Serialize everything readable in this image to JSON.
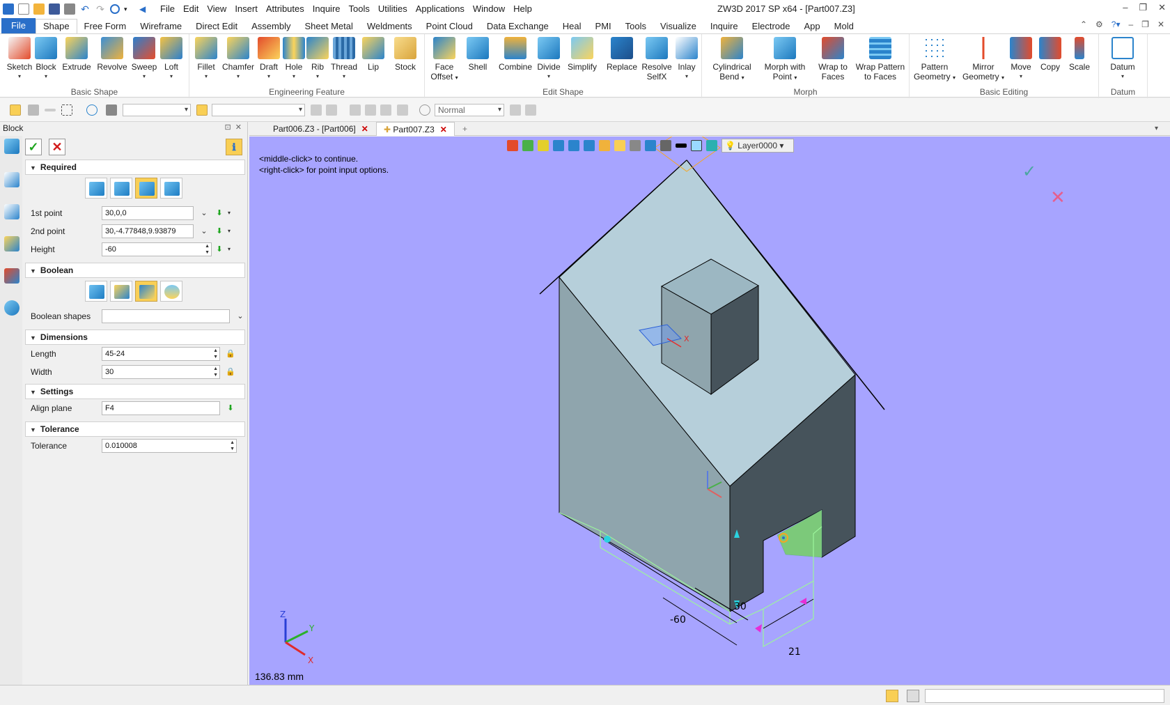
{
  "window": {
    "title": "ZW3D 2017 SP x64 - [Part007.Z3]",
    "menu": [
      "File",
      "Edit",
      "View",
      "Insert",
      "Attributes",
      "Inquire",
      "Tools",
      "Utilities",
      "Applications",
      "Window",
      "Help"
    ]
  },
  "ribbon": {
    "tabs": [
      "File",
      "Shape",
      "Free Form",
      "Wireframe",
      "Direct Edit",
      "Assembly",
      "Sheet Metal",
      "Weldments",
      "Point Cloud",
      "Data Exchange",
      "Heal",
      "PMI",
      "Tools",
      "Visualize",
      "Inquire",
      "Electrode",
      "App",
      "Mold"
    ],
    "active_tab": "Shape",
    "groups": {
      "basic_shape": {
        "title": "Basic Shape",
        "buttons": [
          "Sketch",
          "Block",
          "Extrude",
          "Revolve",
          "Sweep",
          "Loft"
        ]
      },
      "engineering_feature": {
        "title": "Engineering Feature",
        "buttons": [
          "Fillet",
          "Chamfer",
          "Draft",
          "Hole",
          "Rib",
          "Thread",
          "Lip",
          "Stock"
        ]
      },
      "edit_shape": {
        "title": "Edit Shape",
        "buttons": [
          {
            "line1": "Face",
            "line2": "Offset"
          },
          {
            "line1": "Shell",
            "line2": ""
          },
          {
            "line1": "Combine",
            "line2": ""
          },
          {
            "line1": "Divide",
            "line2": ""
          },
          {
            "line1": "Simplify",
            "line2": ""
          },
          {
            "line1": "Replace",
            "line2": ""
          },
          {
            "line1": "Resolve",
            "line2": "SelfX"
          },
          {
            "line1": "Inlay",
            "line2": ""
          }
        ]
      },
      "morph": {
        "title": "Morph",
        "buttons": [
          {
            "line1": "Cylindrical",
            "line2": "Bend"
          },
          {
            "line1": "Morph with",
            "line2": "Point"
          },
          {
            "line1": "Wrap to",
            "line2": "Faces"
          },
          {
            "line1": "Wrap Pattern",
            "line2": "to Faces"
          }
        ]
      },
      "basic_editing": {
        "title": "Basic Editing",
        "buttons": [
          {
            "line1": "Pattern",
            "line2": "Geometry"
          },
          {
            "line1": "Mirror",
            "line2": "Geometry"
          },
          {
            "line1": "Move",
            "line2": ""
          },
          {
            "line1": "Copy",
            "line2": ""
          },
          {
            "line1": "Scale",
            "line2": ""
          }
        ]
      },
      "datum": {
        "title": "Datum",
        "buttons": [
          "Datum"
        ]
      }
    }
  },
  "toolbar2": {
    "render_mode": "Normal"
  },
  "panel": {
    "title": "Block",
    "sections": {
      "required": "Required",
      "boolean": "Boolean",
      "dimensions": "Dimensions",
      "settings": "Settings",
      "tolerance": "Tolerance"
    },
    "fields": {
      "first_point": {
        "label": "1st point",
        "value": "30,0,0"
      },
      "second_point": {
        "label": "2nd point",
        "value": "30,-4.77848,9.93879"
      },
      "height": {
        "label": "Height",
        "value": "-60"
      },
      "boolean_shapes": {
        "label": "Boolean shapes",
        "value": ""
      },
      "length": {
        "label": "Length",
        "value": "45-24"
      },
      "width": {
        "label": "Width",
        "value": "30"
      },
      "align_plane": {
        "label": "Align plane",
        "value": "F4"
      },
      "tolerance": {
        "label": "Tolerance",
        "value": "0.010008"
      }
    }
  },
  "doc_tabs": [
    {
      "label": "Part006.Z3 - [Part006]",
      "active": false
    },
    {
      "label": "Part007.Z3",
      "active": true
    }
  ],
  "viewport": {
    "layer": "Layer0000",
    "prompt_line1": "<middle-click> to continue.",
    "prompt_line2": "<right-click> for point input options.",
    "measurement": "136.83 mm",
    "dim_height": "-60",
    "dim_width": "21",
    "dim_length": "30",
    "axis_labels": {
      "x": "X",
      "y": "Y",
      "z": "Z"
    }
  },
  "colors": {
    "viewport_bg": "#a7a4ff",
    "top_face": "#b6cfda",
    "left_face": "#8fa5ad",
    "dark_face": "#46535b",
    "preview": "#9cf59c",
    "accent": "#2a6fc9"
  }
}
